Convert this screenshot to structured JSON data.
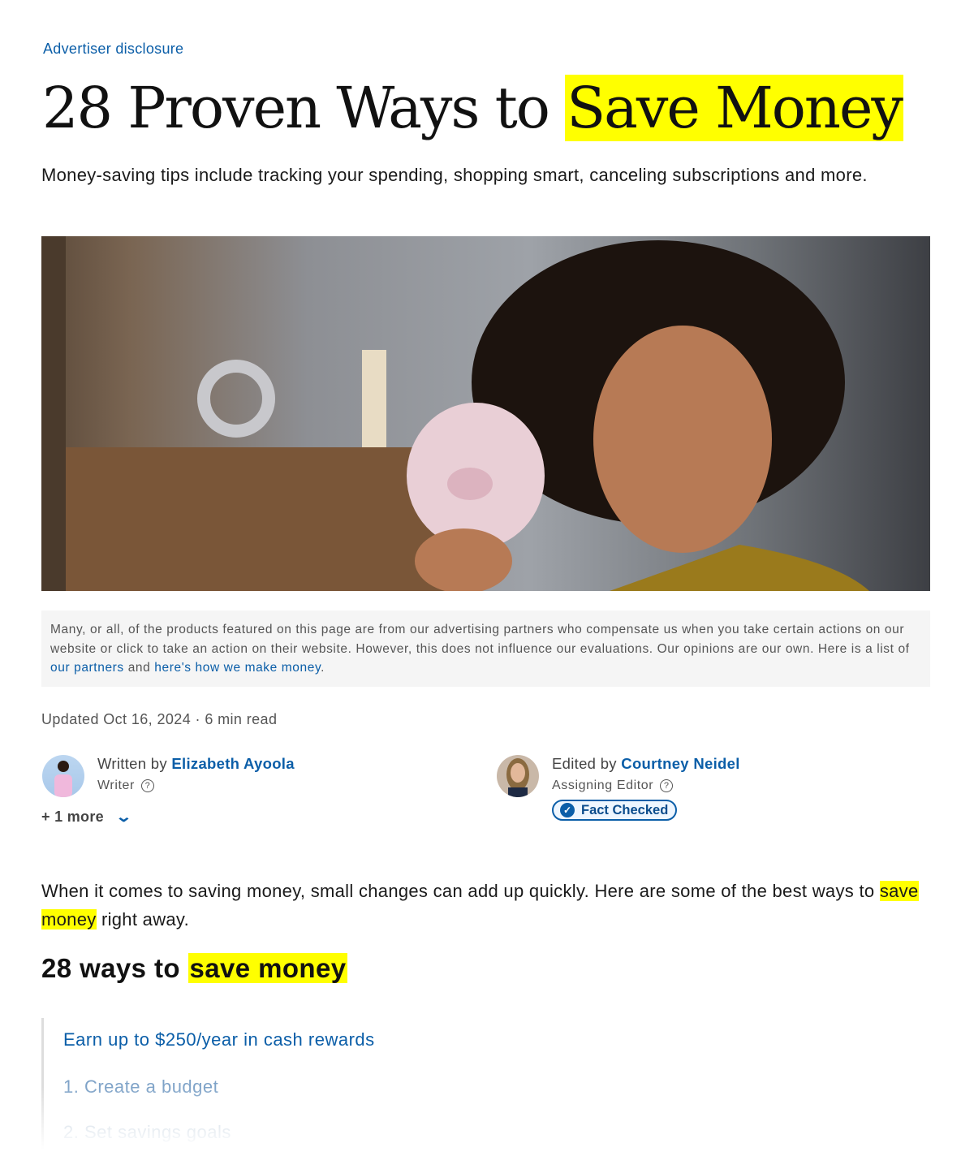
{
  "header": {
    "advertiser_disclosure": "Advertiser disclosure",
    "title_plain": "28 Proven Ways to ",
    "title_highlight": "Save Money",
    "subtitle": "Money-saving tips include tracking your spending, shopping smart, canceling subscriptions and more."
  },
  "hero": {
    "alt": "Woman holding piggy bank"
  },
  "notice": {
    "text": "Many, or all, of the products featured on this page are from our advertising partners who compensate us when you take certain actions on our website or click to take an action on their website. However, this does not influence our evaluations. Our opinions are our own. Here is a list of ",
    "link1": "our partners",
    "mid": " and ",
    "link2": "here's how we make money",
    "end": "."
  },
  "meta": {
    "updated": "Updated Oct 16, 2024 · 6 min read"
  },
  "writer": {
    "prefix": "Written by ",
    "name": "Elizabeth Ayoola",
    "role": "Writer"
  },
  "editor": {
    "prefix": "Edited by ",
    "name": "Courtney Neidel",
    "role": "Assigning Editor",
    "badge": "Fact Checked"
  },
  "more": {
    "label": "+ 1 more"
  },
  "intro": {
    "before": "When it comes to saving money, small changes can add up quickly. Here are some of the best ways to ",
    "highlight": "save money",
    "after": " right away."
  },
  "section": {
    "heading_plain": "28 ways to ",
    "heading_highlight": "save money"
  },
  "toc": {
    "items": [
      "Earn up to $250/year in cash rewards",
      "1. Create a budget",
      "2. Set savings goals"
    ]
  },
  "colors": {
    "link": "#0b5ea8",
    "highlight": "#ffff00"
  }
}
